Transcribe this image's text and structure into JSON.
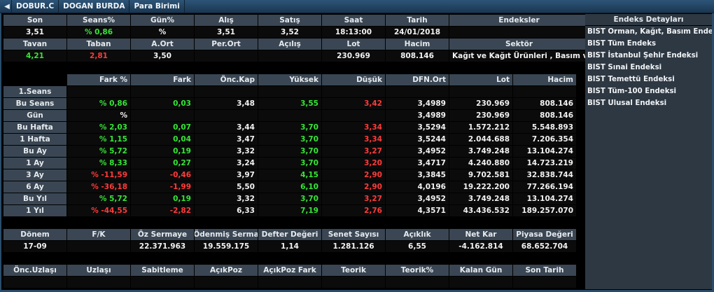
{
  "titlebar": {
    "symbol": "DOBUR.C",
    "name": "DOGAN BURDA",
    "currency": "Para Birimi"
  },
  "summary": {
    "headers1": [
      "Son",
      "Seans%",
      "Gün%",
      "Alış",
      "Satış",
      "Saat",
      "Tarih",
      "Endeksler"
    ],
    "values1": [
      "3,51",
      "% 0,86",
      "%",
      "3,51",
      "3,52",
      "18:13:00",
      "24/01/2018",
      ""
    ],
    "headers2": [
      "Tavan",
      "Taban",
      "A.Ort",
      "Per.Ort",
      "Açılış",
      "Lot",
      "Hacim",
      "Sektör"
    ],
    "values2": [
      "4,21",
      "2,81",
      "3,50",
      "",
      "",
      "230.969",
      "808.146",
      "Kağıt ve Kağıt Ürünleri , Basım ve Yay"
    ]
  },
  "perf": {
    "headers": [
      "",
      "Fark %",
      "Fark",
      "Önc.Kap",
      "Yüksek",
      "Düşük",
      "DFN.Ort",
      "Lot",
      "Hacim"
    ],
    "rows": [
      {
        "label": "1.Seans",
        "fark_pct": "",
        "fark": "",
        "onc": "",
        "yuksek": "",
        "dusuk": "",
        "dfn": "",
        "lot": "",
        "hacim": ""
      },
      {
        "label": "Bu Seans",
        "fark_pct": "% 0,86",
        "fark": "0,03",
        "onc": "3,48",
        "yuksek": "3,55",
        "dusuk": "3,42",
        "dfn": "3,4989",
        "lot": "230.969",
        "hacim": "808.146"
      },
      {
        "label": "Gün",
        "fark_pct": "%",
        "fark": "",
        "onc": "",
        "yuksek": "",
        "dusuk": "",
        "dfn": "3,4989",
        "lot": "230.969",
        "hacim": "808.146"
      },
      {
        "label": "Bu Hafta",
        "fark_pct": "% 2,03",
        "fark": "0,07",
        "onc": "3,44",
        "yuksek": "3,70",
        "dusuk": "3,34",
        "dfn": "3,5294",
        "lot": "1.572.212",
        "hacim": "5.548.893"
      },
      {
        "label": "1 Hafta",
        "fark_pct": "% 1,15",
        "fark": "0,04",
        "onc": "3,47",
        "yuksek": "3,70",
        "dusuk": "3,34",
        "dfn": "3,5244",
        "lot": "2.044.688",
        "hacim": "7.206.354"
      },
      {
        "label": "Bu Ay",
        "fark_pct": "% 5,72",
        "fark": "0,19",
        "onc": "3,32",
        "yuksek": "3,70",
        "dusuk": "3,27",
        "dfn": "3,4952",
        "lot": "3.749.248",
        "hacim": "13.104.274"
      },
      {
        "label": "1 Ay",
        "fark_pct": "% 8,33",
        "fark": "0,27",
        "onc": "3,24",
        "yuksek": "3,70",
        "dusuk": "3,20",
        "dfn": "3,4717",
        "lot": "4.240.880",
        "hacim": "14.723.219"
      },
      {
        "label": "3 Ay",
        "fark_pct": "% -11,59",
        "fark": "-0,46",
        "onc": "3,97",
        "yuksek": "4,15",
        "dusuk": "2,90",
        "dfn": "3,3845",
        "lot": "9.702.581",
        "hacim": "32.838.744"
      },
      {
        "label": "6 Ay",
        "fark_pct": "% -36,18",
        "fark": "-1,99",
        "onc": "5,50",
        "yuksek": "6,10",
        "dusuk": "2,90",
        "dfn": "4,0196",
        "lot": "19.222.200",
        "hacim": "77.266.194"
      },
      {
        "label": "Bu Yıl",
        "fark_pct": "% 5,72",
        "fark": "0,19",
        "onc": "3,32",
        "yuksek": "3,70",
        "dusuk": "3,27",
        "dfn": "3,4952",
        "lot": "3.749.248",
        "hacim": "13.104.274"
      },
      {
        "label": "1 Yıl",
        "fark_pct": "% -44,55",
        "fark": "-2,82",
        "onc": "6,33",
        "yuksek": "7,19",
        "dusuk": "2,76",
        "dfn": "4,3571",
        "lot": "43.436.532",
        "hacim": "189.257.070"
      }
    ]
  },
  "fundamentals": {
    "headers": [
      "Dönem",
      "F/K",
      "Öz Sermaye",
      "Ödenmiş Serma",
      "Defter Değeri",
      "Senet Sayısı",
      "Açıklık",
      "Net Kar",
      "Piyasa Değeri"
    ],
    "values": [
      "17-09",
      "",
      "22.371.963",
      "19.559.175",
      "1,14",
      "1.281.126",
      "6,55",
      "-4.162.814",
      "68.652.704"
    ]
  },
  "viop": {
    "headers": [
      "Önc.Uzlaşı",
      "Uzlaşı",
      "Sabitleme",
      "AçıkPoz",
      "AçıkPoz Fark",
      "Teorik",
      "Teorik%",
      "Kalan Gün",
      "Son Tarih"
    ],
    "values": [
      "",
      "",
      "",
      "",
      "",
      "",
      "",
      "",
      ""
    ]
  },
  "panel": {
    "title": "Endeks Detayları",
    "items": [
      "BIST Orman, Kağıt, Basım Endeksi",
      "BIST Tüm Endeks",
      "BIST İstanbul Şehir Endeksi",
      "BIST Sınai Endeksi",
      "BIST Temettü Endeksi",
      "BIST Tüm-100 Endeksi",
      "BIST Ulusal Endeksi"
    ]
  },
  "colors": {
    "up": "#35e635",
    "down": "#ff3b3b",
    "header_bg": "#3a4653",
    "titlebar": "#24476a"
  }
}
